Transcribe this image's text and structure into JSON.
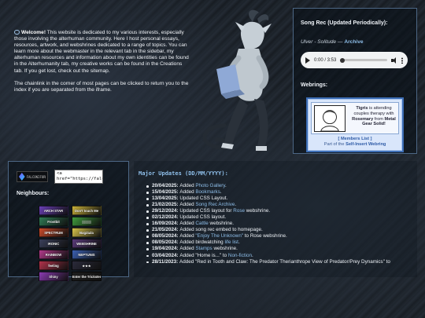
{
  "intro": {
    "welcome_label": "Welcome!",
    "paragraph1": "This website is dedicated to my various interests, especially those involving the alterhuman community. Here I host personal essays, resources, artwork, and webshrines dedicated to a range of topics. You can learn more about the webmaster in the relevant tab in the sidebar, my alterhuman resources and information about my own identities can be found in the Alterhumanity tab, my creative works can be found in the Creations tab. If you get lost, check out the sitemap.",
    "paragraph2": "The chainlink in the corner of most pages can be clicked to return you to the index if you are separated from the iframe."
  },
  "song": {
    "title": "Song Rec (Updated Periodically):",
    "artist": "Ulver - Solitude",
    "separator": "—",
    "archive_link": "Archive",
    "player_time": "0:00 / 3:53",
    "progress_fraction": 0
  },
  "webrings": {
    "title": "Webrings:",
    "ring_line1": "Tigris",
    "ring_line2": "is attending couples therapy with",
    "ring_line3": "Rosemary",
    "ring_line4": "from",
    "ring_line5": "Metal Gear Solid!",
    "members_link": "[ Members List ]",
    "part_of": "Part of the",
    "ring_name": "Self-Insert Webring"
  },
  "left_panel": {
    "site_button_text": "FALCONIFORME",
    "code_snippet": "<a\nhref=\"https://falconi",
    "neighbours_title": "Neighbours:",
    "neighbours": [
      {
        "label": "ARCH STAR",
        "color": "#6a3fb6"
      },
      {
        "label": "Don't touch Me",
        "color": "#c9b13a"
      },
      {
        "label": "Frostbit",
        "color": "#2f7a54"
      },
      {
        "label": "▒▒▒▒",
        "color": "#3f9a3c"
      },
      {
        "label": "SPECTRUM",
        "color": "#c94a2a"
      },
      {
        "label": "BagZaZa",
        "color": "#d6c24a"
      },
      {
        "label": "IRONIC",
        "color": "#3a3f5a"
      },
      {
        "label": "WEBSHRINE",
        "color": "#5a3a7a"
      },
      {
        "label": "RAINBOW",
        "color": "#b03a8a"
      },
      {
        "label": "NEPTUNIS",
        "color": "#3a5fb0"
      },
      {
        "label": "feeling",
        "color": "#b0324a"
      },
      {
        "label": "★★★",
        "color": "#2a2a3a"
      },
      {
        "label": "Shiny",
        "color": "#8a3ab0"
      },
      {
        "label": "Enter the Trickster",
        "color": "#1e1e1e"
      }
    ]
  },
  "updates": {
    "title": "Major Updates (DD/MM/YYYY):",
    "items": [
      {
        "date": "20/04/2025:",
        "pre": "Added ",
        "link": "Photo Gallery",
        "post": "."
      },
      {
        "date": "15/04/2025:",
        "pre": "Added ",
        "link": "Bookmarks",
        "post": "."
      },
      {
        "date": "13/04/2025:",
        "pre": "Updated CSS Layout.",
        "link": "",
        "post": ""
      },
      {
        "date": "21/02/2025:",
        "pre": "Added ",
        "link": "Song Rec Archive",
        "post": "."
      },
      {
        "date": "29/12/2024:",
        "pre": "Updated CSS layout for ",
        "link": "Rose",
        "post": " webshrine."
      },
      {
        "date": "02/12/2024:",
        "pre": "Updated CSS layout.",
        "link": "",
        "post": ""
      },
      {
        "date": "16/09/2024:",
        "pre": "Added ",
        "link": "Cattle",
        "post": " webshrine."
      },
      {
        "date": "21/05/2024:",
        "pre": "Added song rec embed to homepage.",
        "link": "",
        "post": ""
      },
      {
        "date": "08/05/2024:",
        "pre": "Added ",
        "link": "\"Enjoy The Unknown\"",
        "post": " to Rose webshrine."
      },
      {
        "date": "08/05/2024:",
        "pre": "Added birdwatching ",
        "link": "life list",
        "post": "."
      },
      {
        "date": "19/04/2024:",
        "pre": "Added ",
        "link": "Stamps",
        "post": " webshrine."
      },
      {
        "date": "03/04/2024:",
        "pre": "Added \"Home is...\" to ",
        "link": "Non-fiction",
        "post": "."
      },
      {
        "date": "28/11/2023:",
        "pre": "Added \"Red in Tooth and Claw: The Predator Therianthrope View of Predator/Prey Dynamics\" to",
        "link": "",
        "post": ""
      }
    ]
  }
}
